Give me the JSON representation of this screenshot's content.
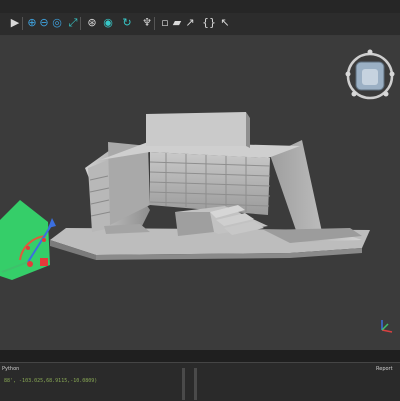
{
  "toolbar": {
    "icons": [
      "play-icon",
      "zoom-in-icon",
      "zoom-out-icon",
      "zoom-fit-icon",
      "pan-icon",
      "select-icon",
      "orbit-icon",
      "rotate-icon",
      "wireframe-icon",
      "box-select-icon",
      "measure-icon",
      "pose-icon",
      "square-icon",
      "folder-icon",
      "export-icon",
      "braces-icon",
      "cursor-icon"
    ]
  },
  "panels": {
    "python_label": "Python",
    "report_label": "Report"
  },
  "console": {
    "line": "88', -103.025,68.9115,-10.0809)"
  },
  "colors": {
    "viewport_bg": "#3b3b3b",
    "model_gray": "#b4b4b4",
    "gizmo_green": "#35d66b",
    "accent_blue": "#3fa3e0"
  }
}
